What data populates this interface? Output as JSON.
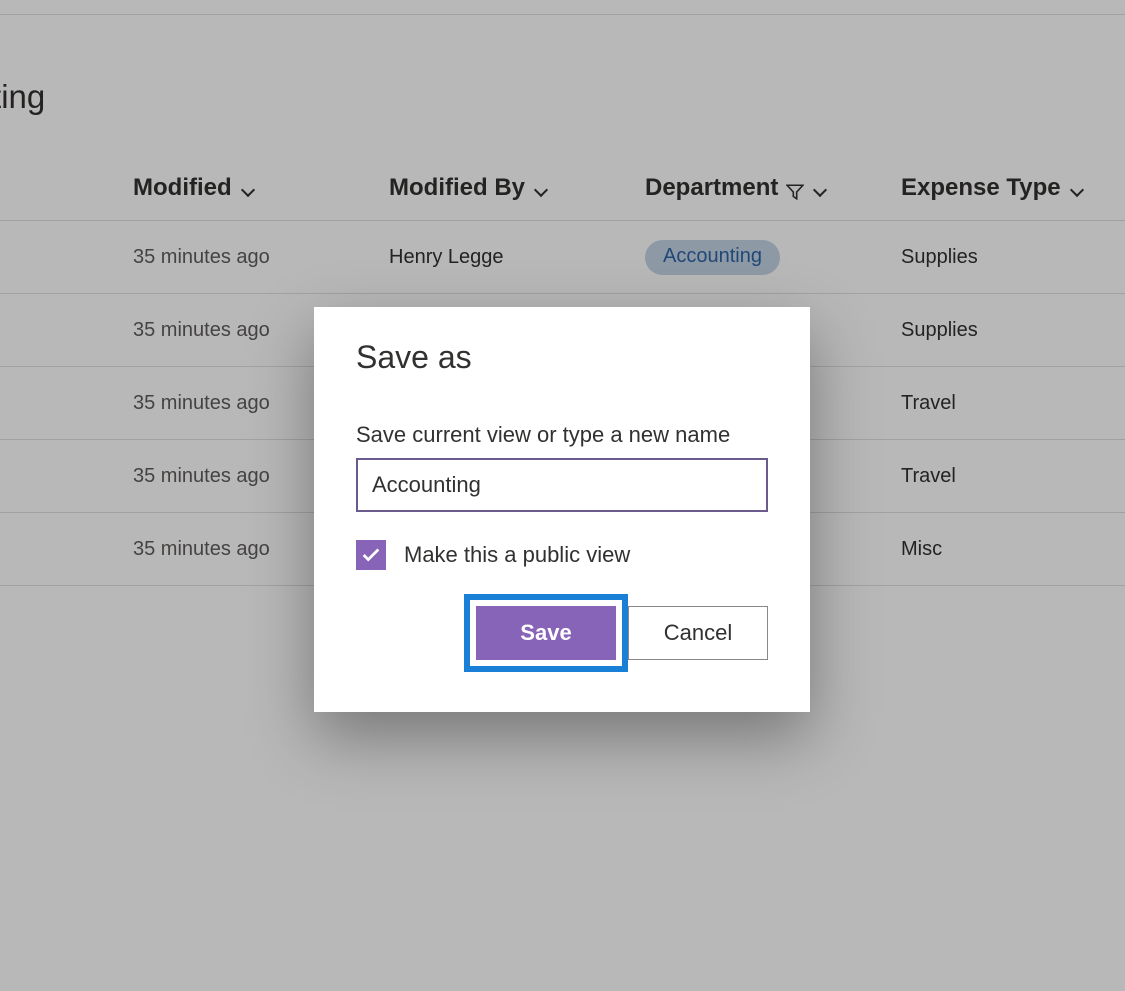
{
  "page": {
    "title_fragment": "ounting"
  },
  "columns": {
    "modified": "Modified",
    "modified_by": "Modified By",
    "department": "Department",
    "expense_type": "Expense Type"
  },
  "rows": [
    {
      "modified": "35 minutes ago",
      "modified_by": "Henry Legge",
      "department": "Accounting",
      "expense_type": "Supplies"
    },
    {
      "modified": "35 minutes ago",
      "modified_by": "",
      "department": "",
      "expense_type": "Supplies"
    },
    {
      "modified": "35 minutes ago",
      "modified_by": "",
      "department": "",
      "expense_type": "Travel"
    },
    {
      "modified": "35 minutes ago",
      "modified_by": "",
      "department": "",
      "expense_type": "Travel"
    },
    {
      "modified": "35 minutes ago",
      "modified_by": "",
      "department": "",
      "expense_type": "Misc"
    }
  ],
  "dialog": {
    "title": "Save as",
    "field_label": "Save current view or type a new name",
    "view_name": "Accounting",
    "checkbox_label": "Make this a public view",
    "checkbox_checked": true,
    "save_label": "Save",
    "cancel_label": "Cancel"
  }
}
